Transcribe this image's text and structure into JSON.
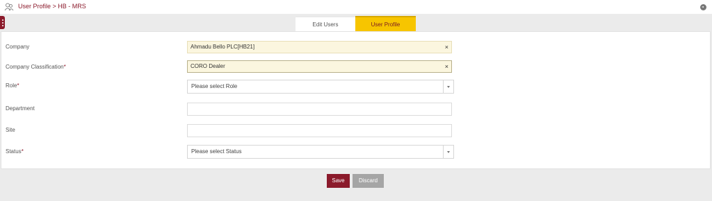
{
  "header": {
    "breadcrumb": "User Profile > HB - MRS",
    "home_icon": "users-icon",
    "back_icon": "back-circle-icon"
  },
  "tabs": [
    {
      "label": "Edit Users",
      "active": false
    },
    {
      "label": "User Profile",
      "active": true
    }
  ],
  "form": {
    "company": {
      "label": "Company",
      "value": "Ahmadu Bello PLC[HB21]",
      "clear": "×"
    },
    "classification": {
      "label": "Company Classification",
      "required": "*",
      "value": "CORO Dealer",
      "clear": "×"
    },
    "role": {
      "label": "Role",
      "required": "*",
      "placeholder": "Please select Role"
    },
    "department": {
      "label": "Department",
      "value": ""
    },
    "site": {
      "label": "Site",
      "value": ""
    },
    "status": {
      "label": "Status",
      "required": "*",
      "placeholder": "Please select Status"
    }
  },
  "actions": {
    "save_label": "Save",
    "discard_label": "Discard"
  },
  "colors": {
    "brand": "#8b1a2b",
    "active_tab": "#f7c500",
    "discard": "#a5a5a5"
  }
}
